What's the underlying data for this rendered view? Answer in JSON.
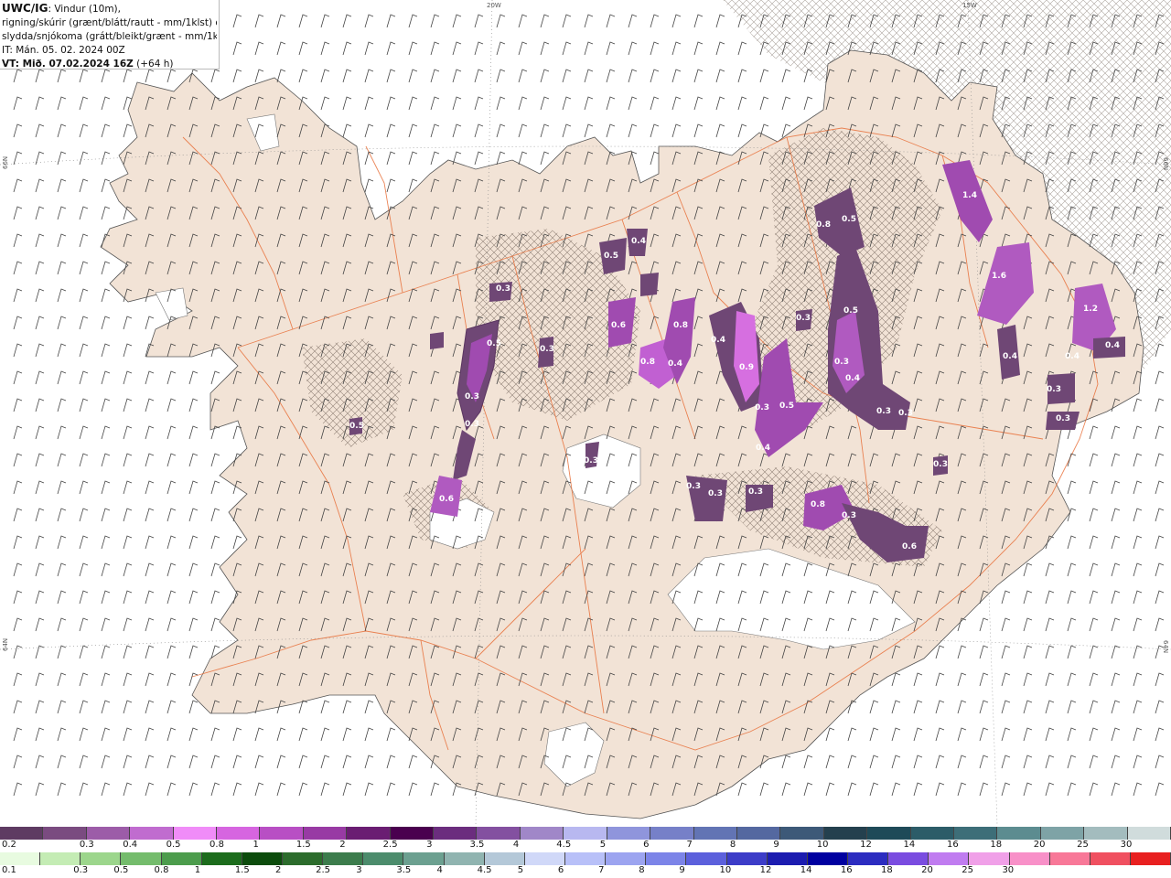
{
  "title": {
    "model": "UWC/IG",
    "line1_rest": ": Vindur (10m),",
    "line2": "rigning/skúrir (grænt/blátt/rautt - mm/1klst) og",
    "line3": "slydda/snjókoma (grátt/bleikt/grænt - mm/1klst)",
    "line4": "IT: Mán. 05. 02. 2024 00Z",
    "valid_label": "VT: Mið. 07.02.2024 16Z",
    "valid_offset": " (+64 h)"
  },
  "coords": {
    "top_20w": "20W",
    "top_15w": "15W",
    "left_66n": "66N",
    "left_64n": "64N",
    "right_66n": "66N",
    "right_64n": "64N"
  },
  "precip_values": [
    "0.3",
    "0.4",
    "0.5",
    "0.6",
    "0.8",
    "0.4",
    "0.3",
    "0.5",
    "0.3",
    "0.3",
    "0.6",
    "0.8",
    "0.4",
    "0.9",
    "0.3",
    "0.5",
    "0.4",
    "0.8",
    "0.5",
    "0.5",
    "0.3",
    "0.4",
    "0.4",
    "1.4",
    "1.6",
    "0.4",
    "1.2",
    "0.4",
    "0.3",
    "0.3",
    "0.3",
    "0.3",
    "0.3",
    "0.3",
    "0.3",
    "0.3",
    "0.3",
    "0.8",
    "0.3",
    "0.6",
    "0.3",
    "0.5"
  ],
  "legend": {
    "snow_colors": [
      "#5e3b62",
      "#7a4b80",
      "#9c5ca8",
      "#c06ccf",
      "#f08cf8",
      "#d665e0",
      "#b84fc4",
      "#983aa4",
      "#6a1d72",
      "#4a004f",
      "#6b2d7e",
      "#8350a0",
      "#a087c8",
      "#b8b8f0",
      "#8f95dc",
      "#7680c8",
      "#6274b4",
      "#5468a0",
      "#3d5978",
      "#24404e",
      "#1e4a58",
      "#2c5c68",
      "#3d6e78",
      "#5c8c90",
      "#7ea3a6",
      "#a3bcbe",
      "#d0dcdc"
    ],
    "snow_labels": [
      "0.2",
      "0.3",
      "0.4",
      "0.5",
      "0.8",
      "1",
      "1.5",
      "2",
      "2.5",
      "3",
      "3.5",
      "4",
      "4.5",
      "5",
      "6",
      "7",
      "8",
      "9",
      "10",
      "12",
      "14",
      "16",
      "18",
      "20",
      "25",
      "30"
    ],
    "rain_colors": [
      "#e8fbe0",
      "#c4ecb4",
      "#9cd68c",
      "#74bc6c",
      "#4c9c4c",
      "#1c6c1c",
      "#0c4c0c",
      "#2c6c2c",
      "#3c7c4c",
      "#4c8c6c",
      "#6ca090",
      "#90b4b0",
      "#b4c8d8",
      "#d0d8f8",
      "#b8c0f8",
      "#9ca4f0",
      "#7c84e8",
      "#5c60dc",
      "#3c3cc8",
      "#1c1cb0",
      "#0000a0",
      "#2c2cc0",
      "#7a4ce0",
      "#c07cf0",
      "#f0a0e8",
      "#f890c8",
      "#f87898",
      "#f05060",
      "#e82020"
    ],
    "rain_labels": [
      "0.1",
      "0.3",
      "0.5",
      "0.8",
      "1",
      "1.5",
      "2",
      "2.5",
      "3",
      "3.5",
      "4",
      "4.5",
      "5",
      "6",
      "7",
      "8",
      "9",
      "10",
      "12",
      "14",
      "16",
      "18",
      "20",
      "25",
      "30"
    ]
  }
}
